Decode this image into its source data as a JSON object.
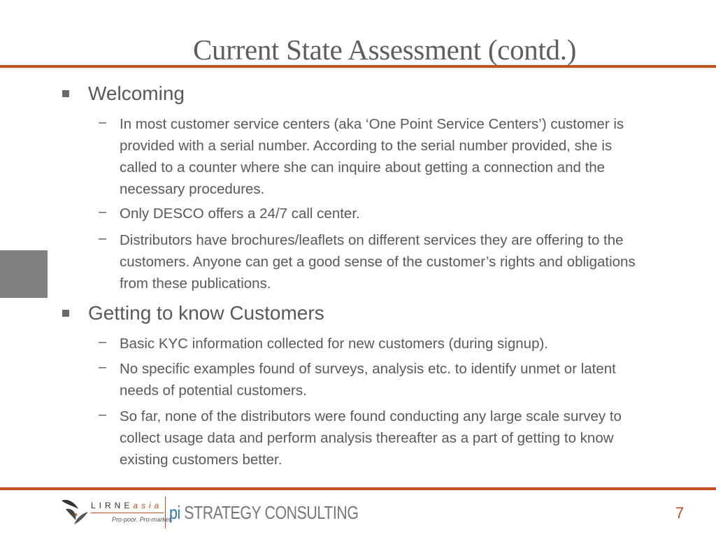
{
  "slide": {
    "title": "Current State Assessment (contd.)",
    "page_number": "7",
    "accent_color": "#c0541f",
    "sections": [
      {
        "heading": "Welcoming",
        "items": [
          "In most customer service centers (aka ‘One Point Service Centers’) customer is provided with a serial number. According to the serial number provided, she is called to a counter where she can inquire about getting a connection and the necessary procedures.",
          "Only DESCO offers a 24/7 call center.",
          "Distributors have brochures/leaflets on different services they are offering to the customers. Anyone can get a good sense of the customer’s rights and obligations from these publications."
        ]
      },
      {
        "heading": "Getting to know Customers",
        "items": [
          "Basic KYC information collected for new customers (during signup).",
          "No specific examples found of surveys, analysis etc. to identify unmet or latent needs of potential customers.",
          "So far, none of the distributors were found conducting any large scale survey to collect usage data and perform analysis thereafter as a part of getting to know existing customers better."
        ]
      }
    ]
  },
  "footer": {
    "lirne_name": "LIRNE",
    "lirne_suffix": "asia",
    "lirne_tagline": "Pro-poor. Pro-market.",
    "pi_prefix": "pi",
    "pi_name": "STRATEGY CONSULTING"
  },
  "icons": {
    "l1_bullet": "square-bullet-icon",
    "l2_bullet": "en-dash-bullet-icon",
    "logo": "lirneasia-logo-icon"
  }
}
